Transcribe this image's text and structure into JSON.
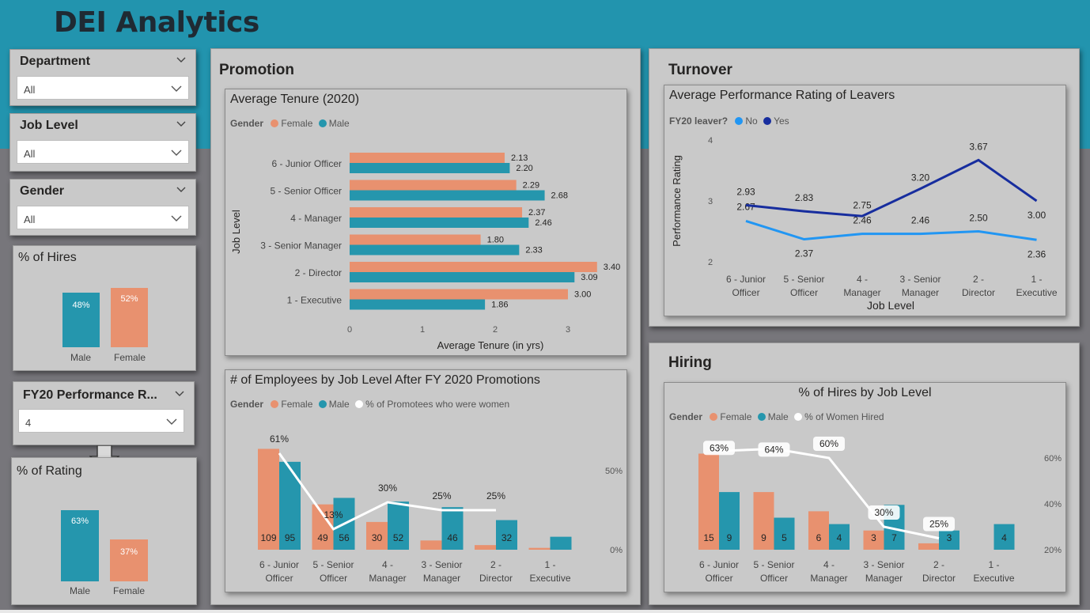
{
  "app": {
    "title": "DEI Analytics"
  },
  "colors": {
    "female": "#e8916f",
    "male": "#2596ad",
    "no": "#2196f3",
    "yes": "#172d9e",
    "header": "#2294ae"
  },
  "icons": {
    "chevron": "chevron-down-icon",
    "arrow": "down-arrow-icon"
  },
  "slicers": [
    {
      "title": "Department",
      "value": "All"
    },
    {
      "title": "Job Level",
      "value": "All"
    },
    {
      "title": "Gender",
      "value": "All"
    },
    {
      "title": "FY20 Performance R...",
      "value": "4"
    }
  ],
  "hires_pct": {
    "title": "% of Hires",
    "bars": [
      {
        "label": "Male",
        "value": 48,
        "text": "48%"
      },
      {
        "label": "Female",
        "value": 52,
        "text": "52%"
      }
    ]
  },
  "rating_pct": {
    "title": "% of Rating",
    "bars": [
      {
        "label": "Male",
        "value": 63,
        "text": "63%"
      },
      {
        "label": "Female",
        "value": 37,
        "text": "37%"
      }
    ]
  },
  "promotion": {
    "title": "Promotion"
  },
  "turnover": {
    "title": "Turnover"
  },
  "hiring": {
    "title": "Hiring"
  },
  "tenure_chart": {
    "title": "Average Tenure (2020)",
    "legend_title": "Gender",
    "legend": [
      "Female",
      "Male"
    ],
    "chart_data": {
      "type": "bar",
      "orientation": "horizontal",
      "categories": [
        "6 - Junior Officer",
        "5 - Senior Officer",
        "4 - Manager",
        "3 - Senior Manager",
        "2 - Director",
        "1 - Executive"
      ],
      "series": [
        {
          "name": "Female",
          "values": [
            2.13,
            2.29,
            2.37,
            1.8,
            3.4,
            3.0
          ],
          "labels": [
            "2.13",
            "2.29",
            "2.37",
            "1.80",
            "3.40",
            "3.00"
          ]
        },
        {
          "name": "Male",
          "values": [
            2.2,
            2.68,
            2.46,
            2.33,
            3.09,
            1.86
          ],
          "labels": [
            "2.20",
            "2.68",
            "2.46",
            "2.33",
            "3.09",
            "1.86"
          ]
        }
      ],
      "xlabel": "Average Tenure (in yrs)",
      "ylabel": "Job Level",
      "xticks": [
        "0",
        "1",
        "2",
        "3"
      ],
      "xlim": [
        0,
        3.4
      ]
    }
  },
  "promo_chart": {
    "title": "# of Employees by Job Level After FY 2020 Promotions",
    "legend_title": "Gender",
    "legend": [
      "Female",
      "Male",
      "% of Promotees who were women"
    ],
    "chart_data": {
      "type": "bar",
      "categories": [
        "6 - Junior Officer",
        "5 - Senior Officer",
        "4 - Manager",
        "3 - Senior Manager",
        "2 - Director",
        "1 - Executive"
      ],
      "series": [
        {
          "name": "Female",
          "values": [
            109,
            49,
            30,
            10,
            5,
            2
          ],
          "labels": [
            "109",
            "49",
            "30",
            "",
            "",
            ""
          ]
        },
        {
          "name": "Male",
          "values": [
            95,
            56,
            52,
            46,
            32,
            14
          ],
          "labels": [
            "95",
            "56",
            "52",
            "46",
            "32",
            ""
          ]
        }
      ],
      "line": {
        "name": "% of Promotees who were women",
        "values": [
          61,
          13,
          30,
          25,
          25,
          null
        ],
        "labels": [
          "61%",
          "13%",
          "30%",
          "25%",
          "25%",
          ""
        ]
      },
      "y2ticks": [
        "50%",
        "0%"
      ],
      "ylim": [
        0,
        120
      ],
      "y2lim": [
        0,
        65
      ]
    }
  },
  "perf_chart": {
    "title": "Average Performance Rating of Leavers",
    "legend_title": "FY20 leaver?",
    "legend": [
      "No",
      "Yes"
    ],
    "chart_data": {
      "type": "line",
      "categories": [
        "6 - Junior Officer",
        "5 - Senior Officer",
        "4 - Manager",
        "3 - Senior Manager",
        "2 - Director",
        "1 - Executive"
      ],
      "series": [
        {
          "name": "No",
          "values": [
            2.67,
            2.37,
            2.46,
            2.46,
            2.5,
            2.36
          ],
          "labels": [
            "2.67",
            "2.37",
            "2.46",
            "2.46",
            "2.50",
            "2.36"
          ]
        },
        {
          "name": "Yes",
          "values": [
            2.93,
            2.83,
            2.75,
            3.2,
            3.67,
            3.0
          ],
          "labels": [
            "2.93",
            "2.83",
            "2.75",
            "3.20",
            "3.67",
            "3.00"
          ]
        }
      ],
      "xlabel": "Job Level",
      "ylabel": "Performance Rating",
      "yticks": [
        "4",
        "3",
        "2"
      ],
      "ylim": [
        2,
        4
      ]
    }
  },
  "hires_chart": {
    "title": "% of Hires by Job Level",
    "legend_title": "Gender",
    "legend": [
      "Female",
      "Male",
      "% of Women Hired"
    ],
    "chart_data": {
      "type": "bar",
      "categories": [
        "6 - Junior Officer",
        "5 - Senior Officer",
        "4 - Manager",
        "3 - Senior Manager",
        "2 - Director",
        "1 - Executive"
      ],
      "series": [
        {
          "name": "Female",
          "values": [
            15,
            9,
            6,
            3,
            1,
            0
          ],
          "labels": [
            "15",
            "9",
            "6",
            "3",
            "",
            ""
          ]
        },
        {
          "name": "Male",
          "values": [
            9,
            5,
            4,
            7,
            3,
            4
          ],
          "labels": [
            "9",
            "5",
            "4",
            "7",
            "3",
            "4"
          ]
        }
      ],
      "line": {
        "name": "% of Women Hired",
        "values": [
          63,
          64,
          60,
          30,
          25,
          null
        ],
        "labels": [
          "63%",
          "64%",
          "60%",
          "30%",
          "25%",
          ""
        ]
      },
      "y2ticks": [
        "60%",
        "40%",
        "20%"
      ],
      "ylim": [
        0,
        16
      ],
      "y2lim": [
        20,
        60
      ]
    }
  }
}
